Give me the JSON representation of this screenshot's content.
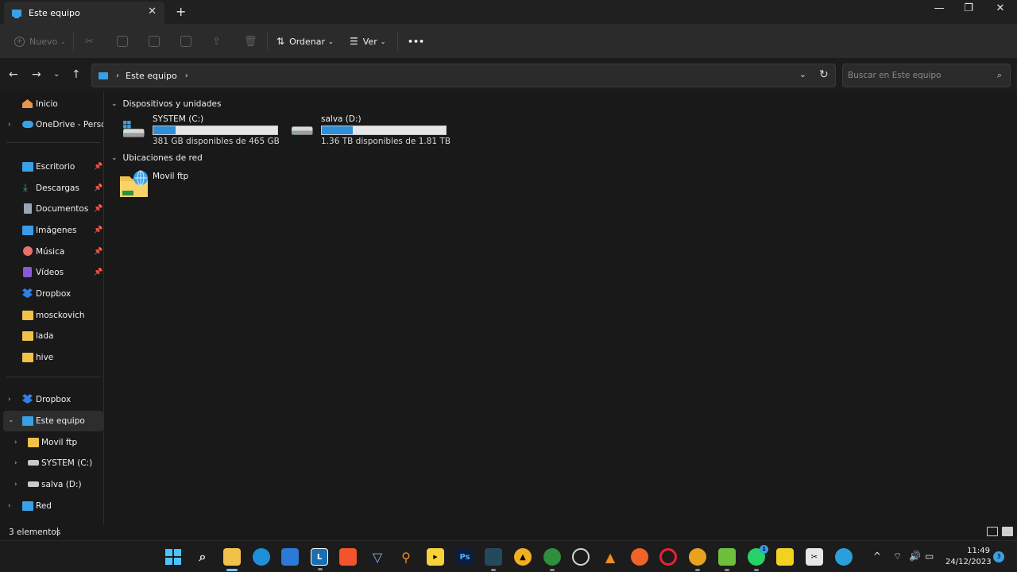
{
  "window": {
    "tab_title": "Este equipo",
    "tab_close": "✕",
    "new_tab": "+",
    "minimize": "—",
    "maximize": "❐",
    "close": "✕"
  },
  "commandbar": {
    "new_label": "Nuevo",
    "sort_label": "Ordenar",
    "view_label": "Ver",
    "more": "•••"
  },
  "address": {
    "path_label": "Este equipo",
    "search_placeholder": "Buscar en Este equipo"
  },
  "sidebar": {
    "home": "Inicio",
    "onedrive": "OneDrive - Personal",
    "quick": [
      {
        "label": "Escritorio",
        "icon": "desktop-icon",
        "color": "#3aa0e6"
      },
      {
        "label": "Descargas",
        "icon": "download-icon",
        "color": "#3fb27f"
      },
      {
        "label": "Documentos",
        "icon": "document-icon",
        "color": "#9aa6b6"
      },
      {
        "label": "Imágenes",
        "icon": "image-icon",
        "color": "#3a9be6"
      },
      {
        "label": "Música",
        "icon": "music-icon",
        "color": "#e8736a"
      },
      {
        "label": "Vídeos",
        "icon": "video-icon",
        "color": "#8a5ad6"
      },
      {
        "label": "Dropbox",
        "icon": "dropbox-icon",
        "color": "#2f7fe8"
      },
      {
        "label": "mosckovich",
        "icon": "folder-icon",
        "color": "#f2c14a"
      },
      {
        "label": "lada",
        "icon": "folder-icon",
        "color": "#f2c14a"
      },
      {
        "label": "hive",
        "icon": "folder-icon",
        "color": "#f2c14a"
      }
    ],
    "tree": {
      "dropbox": "Dropbox",
      "this_pc": "Este equipo",
      "movil_ftp": "Movil ftp",
      "system_c": "SYSTEM (C:)",
      "salva_d": "salva (D:)",
      "network": "Red"
    }
  },
  "main": {
    "devices_header": "Dispositivos y unidades",
    "network_header": "Ubicaciones de red",
    "drives": [
      {
        "name": "SYSTEM (C:)",
        "free_text": "381 GB disponibles de 465 GB",
        "used_fraction": 0.18
      },
      {
        "name": "salva (D:)",
        "free_text": "1.36 TB disponibles de 1.81 TB",
        "used_fraction": 0.25
      }
    ],
    "network_items": [
      {
        "name": "Movil ftp"
      }
    ]
  },
  "status": {
    "count": "3 elementos"
  },
  "taskbar": {
    "time": "11:49",
    "date": "24/12/2023",
    "notifications": "3",
    "whatsapp_badge": "1",
    "tray_chevron": "^"
  }
}
